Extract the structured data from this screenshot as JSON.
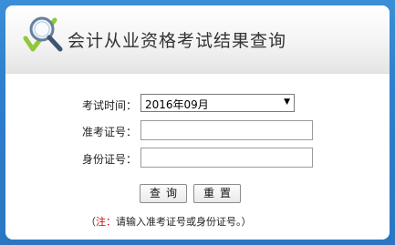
{
  "header": {
    "title": "会计从业资格考试结果查询",
    "logo_icon": "magnifier-check-icon"
  },
  "form": {
    "exam_time": {
      "label": "考试时间：",
      "selected": "2016年09月"
    },
    "ticket_no": {
      "label": "准考证号：",
      "value": ""
    },
    "id_no": {
      "label": "身份证号：",
      "value": ""
    }
  },
  "buttons": {
    "query": "查询",
    "reset": "重置"
  },
  "note": {
    "open": "（",
    "prefix": "注：",
    "text": "请输入准考证号或身份证号。）"
  },
  "colors": {
    "frame": "#2f7fcc",
    "note_accent": "#d90000"
  }
}
